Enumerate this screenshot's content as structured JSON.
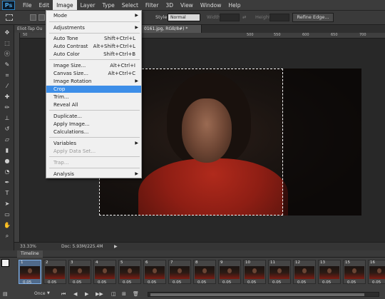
{
  "menubar": {
    "logo": "Ps",
    "items": [
      "File",
      "Edit",
      "Image",
      "Layer",
      "Type",
      "Select",
      "Filter",
      "3D",
      "View",
      "Window",
      "Help"
    ]
  },
  "options": {
    "style_label": "Style:",
    "style_value": "Normal",
    "width_label": "Width:",
    "height_label": "Height:",
    "refine_edge": "Refine Edge..."
  },
  "tabs": [
    "Eliot-Tap Ou",
    "0161.jpg, RGB/8#) *"
  ],
  "ruler": [
    "50",
    "500",
    "550",
    "600",
    "650",
    "700"
  ],
  "status": {
    "zoom": "33.33%",
    "doc": "Doc: 5.93M/225.4M"
  },
  "timeline": {
    "title": "Timeline",
    "loop": "Once",
    "frames": [
      {
        "num": "1",
        "dur": "0.05"
      },
      {
        "num": "2",
        "dur": "0.05"
      },
      {
        "num": "3",
        "dur": "0.05"
      },
      {
        "num": "4",
        "dur": "0.05"
      },
      {
        "num": "5",
        "dur": "0.05"
      },
      {
        "num": "6",
        "dur": "0.05"
      },
      {
        "num": "7",
        "dur": "0.05"
      },
      {
        "num": "8",
        "dur": "0.05"
      },
      {
        "num": "9",
        "dur": "0.05"
      },
      {
        "num": "10",
        "dur": "0.05"
      },
      {
        "num": "11",
        "dur": "0.05"
      },
      {
        "num": "12",
        "dur": "0.05"
      },
      {
        "num": "13",
        "dur": "0.05"
      },
      {
        "num": "15",
        "dur": "0.05"
      },
      {
        "num": "16",
        "dur": "0.05"
      }
    ]
  },
  "image_menu": {
    "items": [
      {
        "label": "Mode",
        "shortcut": "",
        "submenu": true
      },
      {
        "label": "Adjustments",
        "shortcut": "",
        "submenu": true
      },
      {
        "label": "Auto Tone",
        "shortcut": "Shift+Ctrl+L"
      },
      {
        "label": "Auto Contrast",
        "shortcut": "Alt+Shift+Ctrl+L"
      },
      {
        "label": "Auto Color",
        "shortcut": "Shift+Ctrl+B"
      },
      {
        "label": "Image Size...",
        "shortcut": "Alt+Ctrl+I"
      },
      {
        "label": "Canvas Size...",
        "shortcut": "Alt+Ctrl+C"
      },
      {
        "label": "Image Rotation",
        "shortcut": "",
        "submenu": true
      },
      {
        "label": "Crop",
        "shortcut": "",
        "highlighted": true
      },
      {
        "label": "Trim...",
        "shortcut": ""
      },
      {
        "label": "Reveal All",
        "shortcut": ""
      },
      {
        "label": "Duplicate...",
        "shortcut": ""
      },
      {
        "label": "Apply Image...",
        "shortcut": ""
      },
      {
        "label": "Calculations...",
        "shortcut": ""
      },
      {
        "label": "Variables",
        "shortcut": "",
        "submenu": true
      },
      {
        "label": "Apply Data Set...",
        "shortcut": "",
        "disabled": true
      },
      {
        "label": "Trap...",
        "shortcut": "",
        "disabled": true
      },
      {
        "label": "Analysis",
        "shortcut": "",
        "submenu": true
      }
    ]
  },
  "colors": {
    "highlight": "#3d8ee8",
    "foreground": "#f2f2f2",
    "background": "#f0ec9c"
  }
}
